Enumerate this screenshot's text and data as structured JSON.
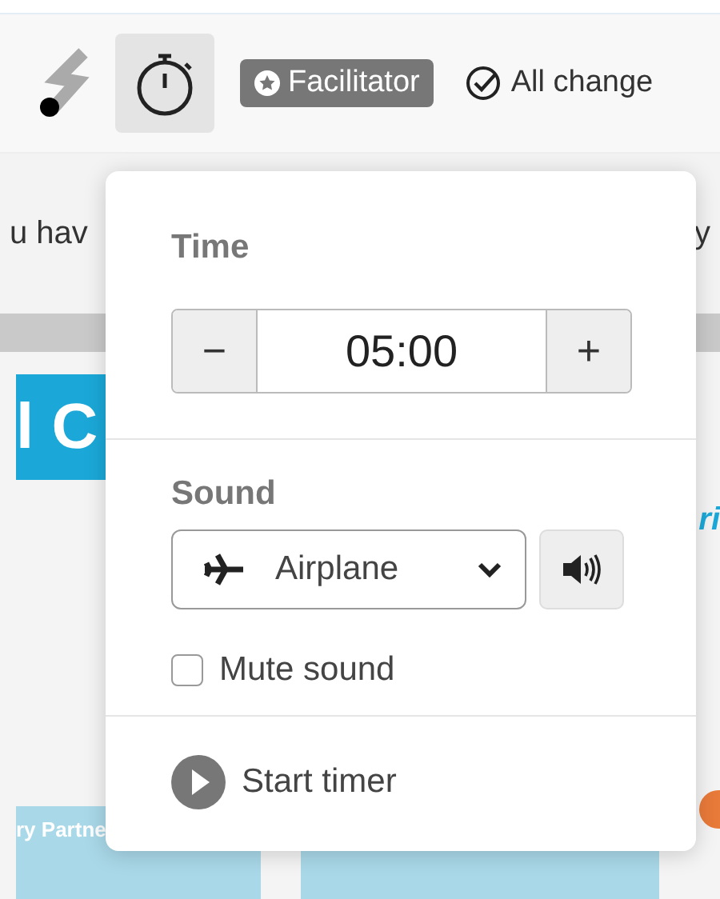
{
  "toolbar": {
    "timer_button": {
      "selected": true
    },
    "role_badge": "Facilitator",
    "save_status": "All change"
  },
  "background": {
    "notice_left": "u hav",
    "notice_right": "y",
    "banner_text": "l C",
    "side_text": "ri",
    "card_title": "ry Partne"
  },
  "timer_popover": {
    "time_label": "Time",
    "decrement": "−",
    "time_value": "05:00",
    "increment": "+",
    "sound_label": "Sound",
    "sound_select": {
      "value": "Airplane"
    },
    "mute": {
      "label": "Mute sound",
      "checked": false
    },
    "start_label": "Start timer"
  }
}
